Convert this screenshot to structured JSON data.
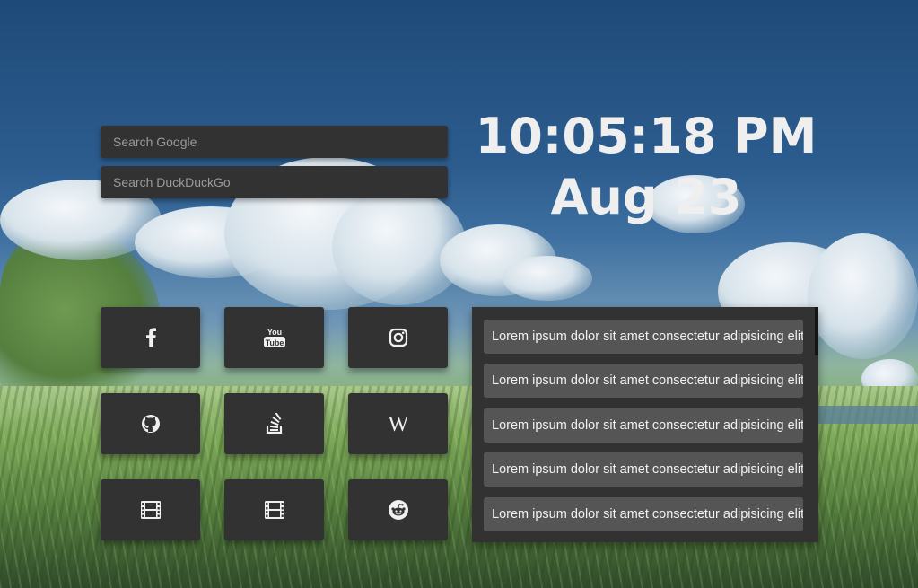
{
  "search": {
    "google_placeholder": "Search Google",
    "duckduckgo_placeholder": "Search DuckDuckGo"
  },
  "clock": {
    "time": "10:05:18 PM",
    "date": "Aug 23"
  },
  "shortcuts": [
    {
      "icon": "facebook-icon"
    },
    {
      "icon": "youtube-icon",
      "text_top": "You",
      "text_bottom": "Tube"
    },
    {
      "icon": "instagram-icon"
    },
    {
      "icon": "github-icon"
    },
    {
      "icon": "stackoverflow-icon"
    },
    {
      "icon": "wikipedia-icon",
      "text": "W"
    },
    {
      "icon": "film-icon"
    },
    {
      "icon": "film-icon"
    },
    {
      "icon": "reddit-icon"
    }
  ],
  "notes": [
    "Lorem ipsum dolor sit amet consectetur adipisicing elit.",
    "Lorem ipsum dolor sit amet consectetur adipisicing elit.",
    "Lorem ipsum dolor sit amet consectetur adipisicing elit.",
    "Lorem ipsum dolor sit amet consectetur adipisicing elit.",
    "Lorem ipsum dolor sit amet consectetur adipisicing elit."
  ],
  "colors": {
    "tile_bg": "#323232",
    "note_bg": "#555555",
    "text": "#efefef"
  }
}
